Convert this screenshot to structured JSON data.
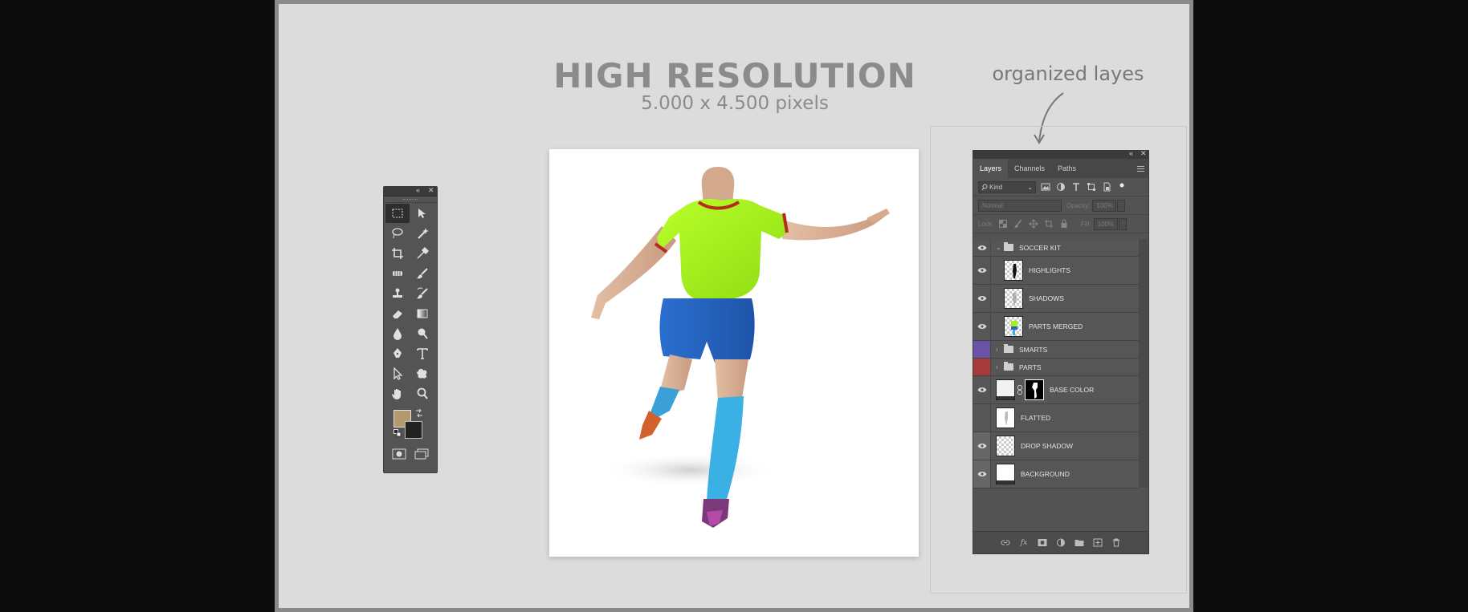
{
  "headline": {
    "title": "HIGH RESOLUTION",
    "subtitle": "5.000 x 4.500 pixels"
  },
  "annotation": "organized layes",
  "tools_panel": {
    "title_icons": [
      "collapse-icon",
      "close-icon"
    ],
    "tools": [
      "rectangular-marquee-icon",
      "move-icon",
      "lasso-icon",
      "magic-wand-icon",
      "crop-icon",
      "eyedropper-icon",
      "healing-brush-icon",
      "brush-icon",
      "clone-stamp-icon",
      "history-brush-icon",
      "eraser-icon",
      "gradient-icon",
      "blur-icon",
      "dodge-icon",
      "pen-icon",
      "type-icon",
      "path-selection-icon",
      "shape-icon",
      "hand-icon",
      "zoom-icon"
    ],
    "foreground_color": "#b5996e",
    "background_color": "#222222"
  },
  "layers_panel": {
    "tabs": [
      "Layers",
      "Channels",
      "Paths"
    ],
    "active_tab": "Layers",
    "filter_kind": "Kind",
    "blend_mode": "Normal",
    "opacity_label": "Opacity:",
    "opacity_value": "100%",
    "lock_label": "Lock:",
    "fill_label": "Fill:",
    "fill_value": "100%",
    "layers": [
      {
        "name": "SOCCER KIT",
        "type": "group-open",
        "visible": true
      },
      {
        "name": "HIGHLIGHTS",
        "type": "layer",
        "visible": true,
        "indent": true
      },
      {
        "name": "SHADOWS",
        "type": "layer",
        "visible": true,
        "indent": true
      },
      {
        "name": "PARTS MERGED",
        "type": "layer",
        "visible": true,
        "indent": true
      },
      {
        "name": "SMARTS",
        "type": "group",
        "color": "#6a52a6"
      },
      {
        "name": "PARTS",
        "type": "group",
        "color": "#a63a3a"
      },
      {
        "name": "BASE COLOR",
        "type": "masked",
        "visible": true
      },
      {
        "name": "FLATTED",
        "type": "layer",
        "visible": false
      },
      {
        "name": "DROP SHADOW",
        "type": "layer",
        "visible": true
      },
      {
        "name": "BACKGROUND",
        "type": "layer",
        "visible": true
      }
    ]
  }
}
